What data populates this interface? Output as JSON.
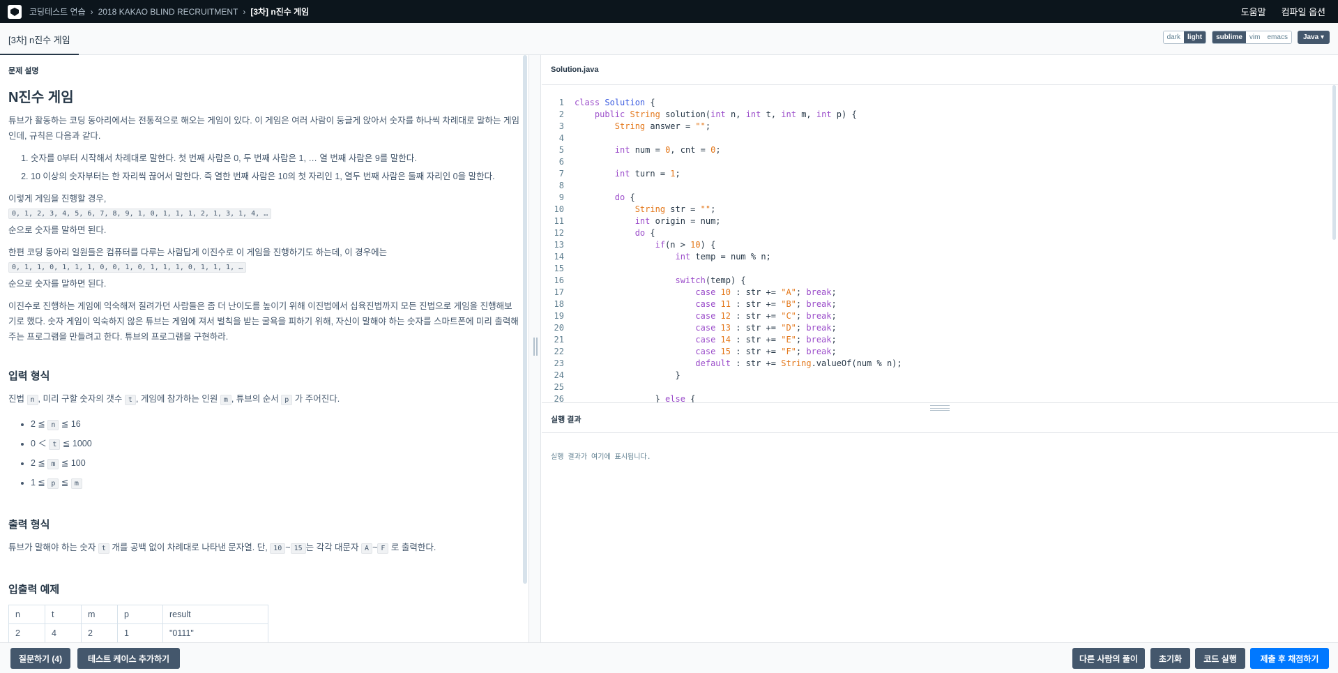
{
  "nav": {
    "breadcrumb": [
      "코딩테스트 연습",
      "2018 KAKAO BLIND RECRUITMENT",
      "[3차] n진수 게임"
    ],
    "help": "도움말",
    "compile_options": "컴파일 옵션"
  },
  "tabbar": {
    "active_tab": "[3차] n진수 게임",
    "theme": [
      "dark",
      "light"
    ],
    "theme_selected": "light",
    "keymap": [
      "sublime",
      "vim",
      "emacs"
    ],
    "keymap_selected": "sublime",
    "language": "Java"
  },
  "problem": {
    "section_label": "문제 설명",
    "title": "N진수 게임",
    "intro": "튜브가 활동하는 코딩 동아리에서는 전통적으로 해오는 게임이 있다. 이 게임은 여러 사람이 둥글게 앉아서 숫자를 하나씩 차례대로 말하는 게임인데, 규칙은 다음과 같다.",
    "rules": [
      "숫자를 0부터 시작해서 차례대로 말한다. 첫 번째 사람은 0, 두 번째 사람은 1, … 열 번째 사람은 9를 말한다.",
      "10 이상의 숫자부터는 한 자리씩 끊어서 말한다. 즉 열한 번째 사람은 10의 첫 자리인 1, 열두 번째 사람은 둘째 자리인 0을 말한다."
    ],
    "ex1_lead": "이렇게 게임을 진행할 경우,",
    "ex1_seq": "0, 1, 2, 3, 4, 5, 6, 7, 8, 9, 1, 0, 1, 1, 1, 2, 1, 3, 1, 4, …",
    "ex1_tail": "순으로 숫자를 말하면 된다.",
    "ex2_lead": "한편 코딩 동아리 일원들은 컴퓨터를 다루는 사람답게 이진수로 이 게임을 진행하기도 하는데, 이 경우에는",
    "ex2_seq": "0, 1, 1, 0, 1, 1, 1, 0, 0, 1, 0, 1, 1, 1, 0, 1, 1, 1, …",
    "ex2_tail": "순으로 숫자를 말하면 된다.",
    "story": "이진수로 진행하는 게임에 익숙해져 질려가던 사람들은 좀 더 난이도를 높이기 위해 이진법에서 십육진법까지 모든 진법으로 게임을 진행해보기로 했다. 숫자 게임이 익숙하지 않은 튜브는 게임에 져서 벌칙을 받는 굴욕을 피하기 위해, 자신이 말해야 하는 숫자를 스마트폰에 미리 출력해주는 프로그램을 만들려고 한다. 튜브의 프로그램을 구현하라.",
    "input_title": "입력 형식",
    "input_desc": {
      "a": "진법",
      "n": "n",
      "b": ", 미리 구할 숫자의 갯수",
      "t": "t",
      "c": ", 게임에 참가하는 인원",
      "m": "m",
      "d": ", 튜브의 순서",
      "p": "p",
      "e": " 가 주어진다."
    },
    "constraints": [
      {
        "pre": "2 ≦",
        "code": "n",
        "post": "≦ 16"
      },
      {
        "pre": "0 ＜",
        "code": "t",
        "post": "≦ 1000"
      },
      {
        "pre": "2 ≦",
        "code": "m",
        "post": "≦ 100"
      },
      {
        "pre": "1 ≦",
        "code": "p",
        "post": "≦",
        "code2": "m"
      }
    ],
    "output_title": "출력 형식",
    "output_desc": {
      "a": "튜브가 말해야 하는 숫자",
      "t": "t",
      "b": "개를 공백 없이 차례대로 나타낸 문자열. 단,",
      "c10": "10",
      "tilde1": "~",
      "c15": "15",
      "c": "는 각각 대문자",
      "A": "A",
      "tilde2": "~",
      "F": "F",
      "d": "로 출력한다."
    },
    "examples_title": "입출력 예제",
    "examples": {
      "headers": [
        "n",
        "t",
        "m",
        "p",
        "result"
      ],
      "rows": [
        [
          "2",
          "4",
          "2",
          "1",
          "\"0111\""
        ]
      ]
    }
  },
  "editor": {
    "filename": "Solution.java",
    "line_numbers": [
      "1",
      "2",
      "3",
      "4",
      "5",
      "6",
      "7",
      "8",
      "9",
      "10",
      "11",
      "12",
      "13",
      "14",
      "15",
      "16",
      "17",
      "18",
      "19",
      "20",
      "21",
      "22",
      "23",
      "24",
      "25",
      "26"
    ]
  },
  "result": {
    "title": "실행 결과",
    "placeholder": "실행 결과가 여기에 표시됩니다."
  },
  "footer": {
    "ask": "질문하기 (4)",
    "add_testcase": "테스트 케이스 추가하기",
    "others": "다른 사람의 풀이",
    "reset": "초기화",
    "run": "코드 실행",
    "submit": "제출 후 채점하기"
  }
}
